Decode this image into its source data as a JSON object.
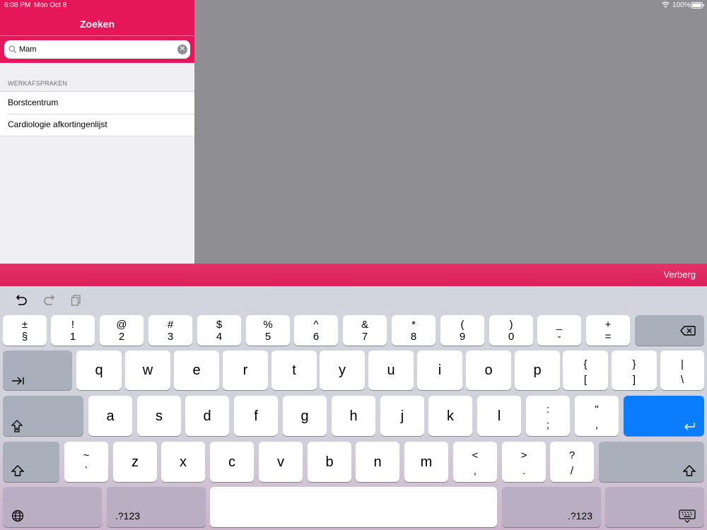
{
  "status_bar": {
    "time": "6:08 PM",
    "date": "Mon Oct 8",
    "battery": "100%"
  },
  "sidebar": {
    "title": "Zoeken",
    "search": {
      "value": "Mam",
      "placeholder": ""
    },
    "section_header": "WERKAFSPRAKEN",
    "items": [
      {
        "label": "Borstcentrum"
      },
      {
        "label": "Cardiologie afkortingenlijst"
      }
    ]
  },
  "accessory": {
    "hide_label": "Verberg"
  },
  "keyboard": {
    "toolbar": {
      "undo": "undo-icon",
      "redo": "redo-icon",
      "paste": "paste-icon"
    },
    "number_row": [
      {
        "top": "±",
        "bottom": "§"
      },
      {
        "top": "!",
        "bottom": "1"
      },
      {
        "top": "@",
        "bottom": "2"
      },
      {
        "top": "#",
        "bottom": "3"
      },
      {
        "top": "$",
        "bottom": "4"
      },
      {
        "top": "%",
        "bottom": "5"
      },
      {
        "top": "^",
        "bottom": "6"
      },
      {
        "top": "&",
        "bottom": "7"
      },
      {
        "top": "*",
        "bottom": "8"
      },
      {
        "top": "(",
        "bottom": "9"
      },
      {
        "top": ")",
        "bottom": "0"
      },
      {
        "top": "_",
        "bottom": "-"
      },
      {
        "top": "+",
        "bottom": "="
      }
    ],
    "row_q": [
      "q",
      "w",
      "e",
      "r",
      "t",
      "y",
      "u",
      "i",
      "o",
      "p"
    ],
    "row_q_symbols": [
      {
        "top": "{",
        "bottom": "["
      },
      {
        "top": "}",
        "bottom": "]"
      },
      {
        "top": "|",
        "bottom": "\\"
      }
    ],
    "row_a": [
      "a",
      "s",
      "d",
      "f",
      "g",
      "h",
      "j",
      "k",
      "l"
    ],
    "row_a_symbols": [
      {
        "top": ":",
        "bottom": ";"
      },
      {
        "top": "\"",
        "bottom": ","
      }
    ],
    "row_z_tilde": {
      "top": "~",
      "bottom": "`"
    },
    "row_z": [
      "z",
      "x",
      "c",
      "v",
      "b",
      "n",
      "m"
    ],
    "row_z_symbols": [
      {
        "top": "<",
        "bottom": ","
      },
      {
        "top": ">",
        "bottom": "."
      },
      {
        "top": "?",
        "bottom": "/"
      }
    ],
    "numbers_label": ".?123",
    "icons": {
      "delete": "delete-icon",
      "tab": "tab-icon",
      "caps": "caps-lock-icon",
      "return": "return-icon",
      "shift": "shift-icon",
      "globe": "globe-icon",
      "dismiss": "keyboard-dismiss-icon"
    },
    "colors": {
      "accent": "#e5175a",
      "return_key": "#0a7dff",
      "detail_bg": "#8e8e93"
    }
  }
}
